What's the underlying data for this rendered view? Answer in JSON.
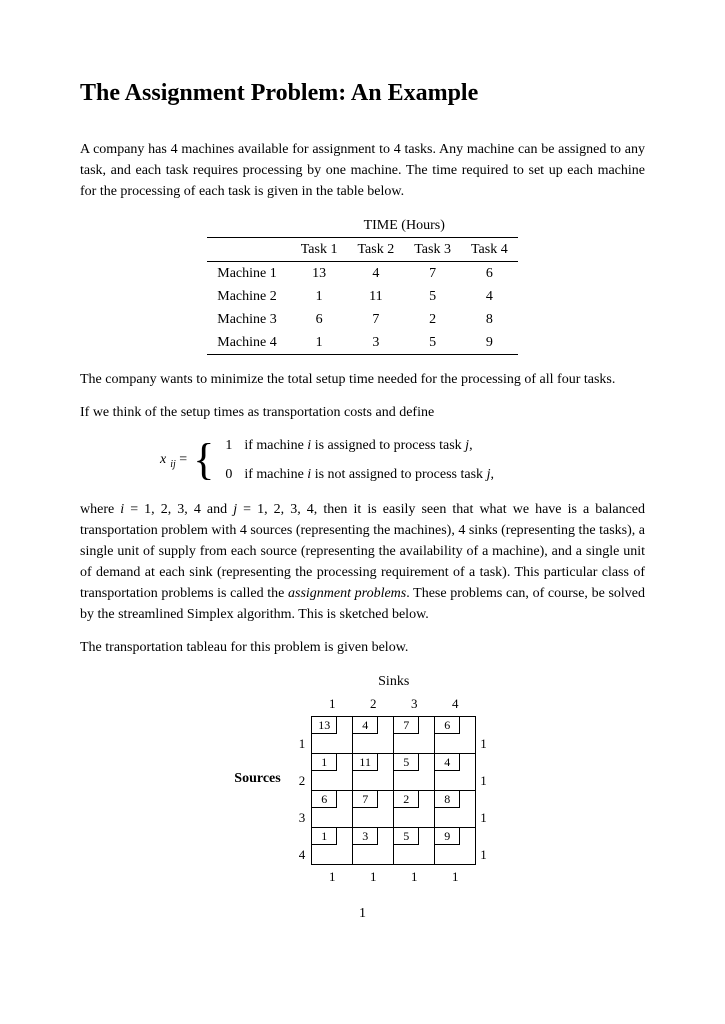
{
  "title": "The Assignment Problem: An Example",
  "para1": "A company has 4 machines available for assignment to 4 tasks. Any machine can be assigned to any task, and each task requires processing by one machine. The time required to set up each machine for the processing of each task is given in the table below.",
  "table": {
    "super_header": "TIME (Hours)",
    "columns": [
      "Task 1",
      "Task 2",
      "Task 3",
      "Task 4"
    ],
    "rows": [
      {
        "label": "Machine 1",
        "values": [
          "13",
          "4",
          "7",
          "6"
        ]
      },
      {
        "label": "Machine 2",
        "values": [
          "1",
          "11",
          "5",
          "4"
        ]
      },
      {
        "label": "Machine 3",
        "values": [
          "6",
          "7",
          "2",
          "8"
        ]
      },
      {
        "label": "Machine 4",
        "values": [
          "1",
          "3",
          "5",
          "9"
        ]
      }
    ]
  },
  "para2": "The company wants to minimize the total setup time needed for the processing of all four tasks.",
  "para3": "If we think of the setup times as transportation costs and define",
  "equation": {
    "var_html": "x",
    "sub_html": "ij",
    "eq": " = ",
    "case1_val": "1",
    "case1_txt_pre": "if machine ",
    "case1_i": "i",
    "case1_mid": " is assigned to process task ",
    "case1_j": "j",
    "case1_end": ",",
    "case0_val": "0",
    "case0_txt_pre": "if machine ",
    "case0_i": "i",
    "case0_mid": " is not assigned to process task ",
    "case0_j": "j",
    "case0_end": ","
  },
  "para4_pre": "where ",
  "para4_i": "i",
  "para4_mid1": " = 1, 2, 3, 4 and ",
  "para4_j": "j",
  "para4_post": " = 1, 2, 3, 4, then it is easily seen that what we have is a balanced transportation problem with 4 sources (representing the machines), 4 sinks (representing the tasks), a single unit of supply from each source (representing the availability of a machine), and a single unit of demand at each sink (representing the processing requirement of a task). This particular class of transportation problems is called the ",
  "para4_em": "assignment problems",
  "para4_tail": ". These problems can, of course, be solved by the streamlined Simplex algorithm. This is sketched below.",
  "para5": "The transportation tableau for this problem is given below.",
  "tableau": {
    "sinks_label": "Sinks",
    "sources_label": "Sources",
    "col_idx": [
      "1",
      "2",
      "3",
      "4"
    ],
    "row_idx": [
      "1",
      "2",
      "3",
      "4"
    ],
    "costs": [
      [
        "13",
        "4",
        "7",
        "6"
      ],
      [
        "1",
        "11",
        "5",
        "4"
      ],
      [
        "6",
        "7",
        "2",
        "8"
      ],
      [
        "1",
        "3",
        "5",
        "9"
      ]
    ],
    "supply": [
      "1",
      "1",
      "1",
      "1"
    ],
    "demand": [
      "1",
      "1",
      "1",
      "1"
    ]
  },
  "chart_data": {
    "type": "table",
    "title": "Transportation tableau (assignment problem)",
    "row_labels": [
      "Source 1",
      "Source 2",
      "Source 3",
      "Source 4"
    ],
    "col_labels": [
      "Sink 1",
      "Sink 2",
      "Sink 3",
      "Sink 4"
    ],
    "costs": [
      [
        13,
        4,
        7,
        6
      ],
      [
        1,
        11,
        5,
        4
      ],
      [
        6,
        7,
        2,
        8
      ],
      [
        1,
        3,
        5,
        9
      ]
    ],
    "supply": [
      1,
      1,
      1,
      1
    ],
    "demand": [
      1,
      1,
      1,
      1
    ]
  },
  "page_number": "1"
}
